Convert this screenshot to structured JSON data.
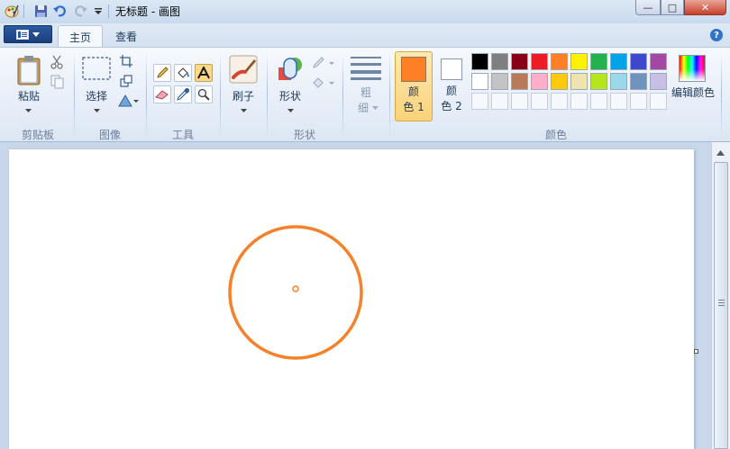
{
  "window": {
    "title": "无标题 - 画图",
    "controls": {
      "minimize": "—",
      "maximize": "□",
      "close": "✕"
    }
  },
  "tabs": [
    {
      "label": "主页",
      "active": true
    },
    {
      "label": "查看",
      "active": false
    }
  ],
  "help": "?",
  "ribbon": {
    "clipboard": {
      "paste_label": "粘贴",
      "group_label": "剪贴板"
    },
    "image": {
      "select_label": "选择",
      "group_label": "图像"
    },
    "tools": {
      "group_label": "工具"
    },
    "brushes": {
      "label": "刷子"
    },
    "shapes": {
      "label": "形状",
      "group_label": "形状"
    },
    "size": {
      "label_line1": "粗",
      "label_line2": "细"
    },
    "colors": {
      "color1_line1": "颜",
      "color1_line2": "色 1",
      "color2_line1": "颜",
      "color2_line2": "色 2",
      "edit_label": "编辑颜色",
      "group_label": "颜色",
      "color1_value": "#ff7f27",
      "color2_value": "#ffffff",
      "palette_row1": [
        "#000000",
        "#7f7f7f",
        "#880015",
        "#ed1c24",
        "#ff7f27",
        "#fff200",
        "#22b14c",
        "#00a2e8",
        "#3f48cc",
        "#a349a4"
      ],
      "palette_row2": [
        "#ffffff",
        "#c3c3c3",
        "#b97a57",
        "#ffaec9",
        "#ffc90e",
        "#efe4b0",
        "#b5e61d",
        "#99d9ea",
        "#7092be",
        "#c8bfe7"
      ]
    }
  },
  "canvas": {
    "background": "#ffffff",
    "shape": {
      "type": "circle",
      "stroke": "#f5812a"
    }
  }
}
